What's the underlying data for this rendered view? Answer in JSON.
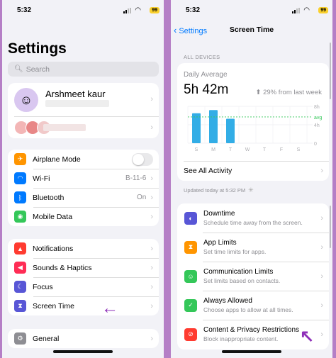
{
  "left": {
    "status": {
      "time": "5:32",
      "battery": "99"
    },
    "title": "Settings",
    "search": {
      "placeholder": "Search"
    },
    "profile": {
      "name": "Arshmeet kaur"
    },
    "connectivity": [
      {
        "label": "Airplane Mode",
        "icon": "airplane-icon",
        "color": "#ff9500",
        "toggle": true
      },
      {
        "label": "Wi-Fi",
        "value": "B-11-6",
        "icon": "wifi-icon",
        "color": "#007aff"
      },
      {
        "label": "Bluetooth",
        "value": "On",
        "icon": "bluetooth-icon",
        "color": "#007aff"
      },
      {
        "label": "Mobile Data",
        "icon": "antenna-icon",
        "color": "#34c759"
      }
    ],
    "notifications": [
      {
        "label": "Notifications",
        "icon": "bell-icon",
        "color": "#ff3b30"
      },
      {
        "label": "Sounds & Haptics",
        "icon": "speaker-icon",
        "color": "#ff2d55"
      },
      {
        "label": "Focus",
        "icon": "moon-icon",
        "color": "#5856d6"
      },
      {
        "label": "Screen Time",
        "icon": "hourglass-icon",
        "color": "#5856d6"
      }
    ],
    "general": [
      {
        "label": "General",
        "icon": "gear-icon",
        "color": "#8e8e93"
      }
    ]
  },
  "right": {
    "status": {
      "time": "5:32",
      "battery": "99"
    },
    "nav": {
      "back": "Settings",
      "title": "Screen Time"
    },
    "section": "ALL DEVICES",
    "daily": {
      "label": "Daily Average",
      "value": "5h 42m",
      "delta": "29% from last week"
    },
    "chart_data": {
      "type": "bar",
      "categories": [
        "S",
        "M",
        "T",
        "W",
        "T",
        "F",
        "S"
      ],
      "values": [
        6.5,
        7.2,
        5.3,
        null,
        null,
        null,
        null
      ],
      "y_ticks": [
        "8h",
        "4h",
        "0"
      ],
      "average": 5.7,
      "average_label": "avg",
      "ylim": [
        0,
        8
      ],
      "color": "#32ade6"
    },
    "see_all": "See All Activity",
    "updated": "Updated today at 5:32 PM",
    "items": [
      {
        "title": "Downtime",
        "subtitle": "Schedule time away from the screen.",
        "icon": "downtime-icon",
        "color": "#5856d6"
      },
      {
        "title": "App Limits",
        "subtitle": "Set time limits for apps.",
        "icon": "hourglass-icon",
        "color": "#ff9500"
      },
      {
        "title": "Communication Limits",
        "subtitle": "Set limits based on contacts.",
        "icon": "person-icon",
        "color": "#34c759"
      },
      {
        "title": "Always Allowed",
        "subtitle": "Choose apps to allow at all times.",
        "icon": "checkmark-icon",
        "color": "#34c759"
      },
      {
        "title": "Content & Privacy Restrictions",
        "subtitle": "Block inappropriate content.",
        "icon": "restriction-icon",
        "color": "#ff3b30"
      }
    ]
  }
}
